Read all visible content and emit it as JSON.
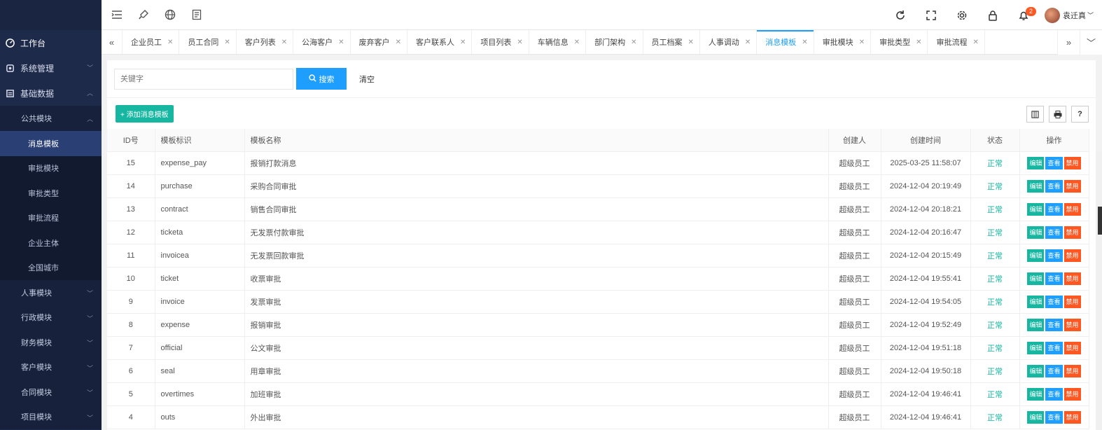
{
  "sidebar": {
    "items_top": [
      {
        "label": "工作台",
        "icon": "dashboard-icon"
      },
      {
        "label": "系统管理",
        "icon": "settings-icon"
      },
      {
        "label": "基础数据",
        "icon": "database-icon"
      }
    ],
    "sub_public": "公共模块",
    "public_items": [
      "消息模板",
      "审批模块",
      "审批类型",
      "审批流程",
      "企业主体",
      "全国城市"
    ],
    "groups": [
      "人事模块",
      "行政模块",
      "财务模块",
      "客户模块",
      "合同模块",
      "项目模块"
    ]
  },
  "topbar": {
    "left_icons": [
      "menu-toggle-icon",
      "brush-icon",
      "globe-icon",
      "note-icon"
    ],
    "right_icons": [
      "refresh-icon",
      "fullscreen-icon",
      "gear-icon",
      "lock-icon",
      "bell-icon"
    ],
    "notification_count": "2",
    "user_name": "袁迁真"
  },
  "tabs": [
    {
      "label": "企业员工",
      "active": false
    },
    {
      "label": "员工合同",
      "active": false
    },
    {
      "label": "客户列表",
      "active": false
    },
    {
      "label": "公海客户",
      "active": false
    },
    {
      "label": "废弃客户",
      "active": false
    },
    {
      "label": "客户联系人",
      "active": false
    },
    {
      "label": "项目列表",
      "active": false
    },
    {
      "label": "车辆信息",
      "active": false
    },
    {
      "label": "部门架构",
      "active": false
    },
    {
      "label": "员工档案",
      "active": false
    },
    {
      "label": "人事调动",
      "active": false
    },
    {
      "label": "消息模板",
      "active": true
    },
    {
      "label": "审批模块",
      "active": false
    },
    {
      "label": "审批类型",
      "active": false
    },
    {
      "label": "审批流程",
      "active": false
    }
  ],
  "search": {
    "placeholder": "关键字",
    "button_label": "搜索",
    "clear_label": "清空"
  },
  "toolbar": {
    "add_label": "+ 添加消息模板"
  },
  "table": {
    "headers": [
      "ID号",
      "模板标识",
      "模板名称",
      "创建人",
      "创建时间",
      "状态",
      "操作"
    ],
    "op_labels": {
      "edit": "编辑",
      "view": "查看",
      "disable": "禁用"
    },
    "rows": [
      {
        "id": "15",
        "key": "expense_pay",
        "name": "报销打款消息",
        "creator": "超级员工",
        "time": "2025-03-25 11:58:07",
        "status": "正常"
      },
      {
        "id": "14",
        "key": "purchase",
        "name": "采购合同审批",
        "creator": "超级员工",
        "time": "2024-12-04 20:19:49",
        "status": "正常"
      },
      {
        "id": "13",
        "key": "contract",
        "name": "销售合同审批",
        "creator": "超级员工",
        "time": "2024-12-04 20:18:21",
        "status": "正常"
      },
      {
        "id": "12",
        "key": "ticketa",
        "name": "无发票付款审批",
        "creator": "超级员工",
        "time": "2024-12-04 20:16:47",
        "status": "正常"
      },
      {
        "id": "11",
        "key": "invoicea",
        "name": "无发票回款审批",
        "creator": "超级员工",
        "time": "2024-12-04 20:15:49",
        "status": "正常"
      },
      {
        "id": "10",
        "key": "ticket",
        "name": "收票审批",
        "creator": "超级员工",
        "time": "2024-12-04 19:55:41",
        "status": "正常"
      },
      {
        "id": "9",
        "key": "invoice",
        "name": "发票审批",
        "creator": "超级员工",
        "time": "2024-12-04 19:54:05",
        "status": "正常"
      },
      {
        "id": "8",
        "key": "expense",
        "name": "报销审批",
        "creator": "超级员工",
        "time": "2024-12-04 19:52:49",
        "status": "正常"
      },
      {
        "id": "7",
        "key": "official",
        "name": "公文审批",
        "creator": "超级员工",
        "time": "2024-12-04 19:51:18",
        "status": "正常"
      },
      {
        "id": "6",
        "key": "seal",
        "name": "用章审批",
        "creator": "超级员工",
        "time": "2024-12-04 19:50:18",
        "status": "正常"
      },
      {
        "id": "5",
        "key": "overtimes",
        "name": "加班审批",
        "creator": "超级员工",
        "time": "2024-12-04 19:46:41",
        "status": "正常"
      },
      {
        "id": "4",
        "key": "outs",
        "name": "外出审批",
        "creator": "超级员工",
        "time": "2024-12-04 19:46:41",
        "status": "正常"
      }
    ]
  }
}
